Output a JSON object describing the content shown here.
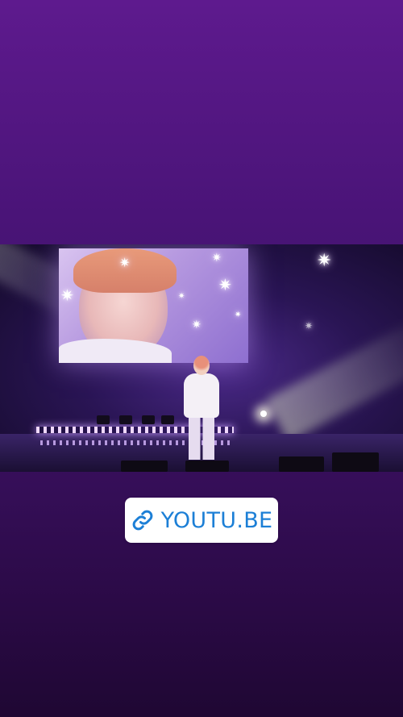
{
  "link_sticker": {
    "label": "YOUTU.BE",
    "icon": "link-icon",
    "text_color": "#1c7fd6",
    "background_color": "#ffffff"
  },
  "background": {
    "gradient_top": "#5e1a8e",
    "gradient_bottom": "#1f0733"
  },
  "photo": {
    "sparkle_glyph": "✷"
  }
}
